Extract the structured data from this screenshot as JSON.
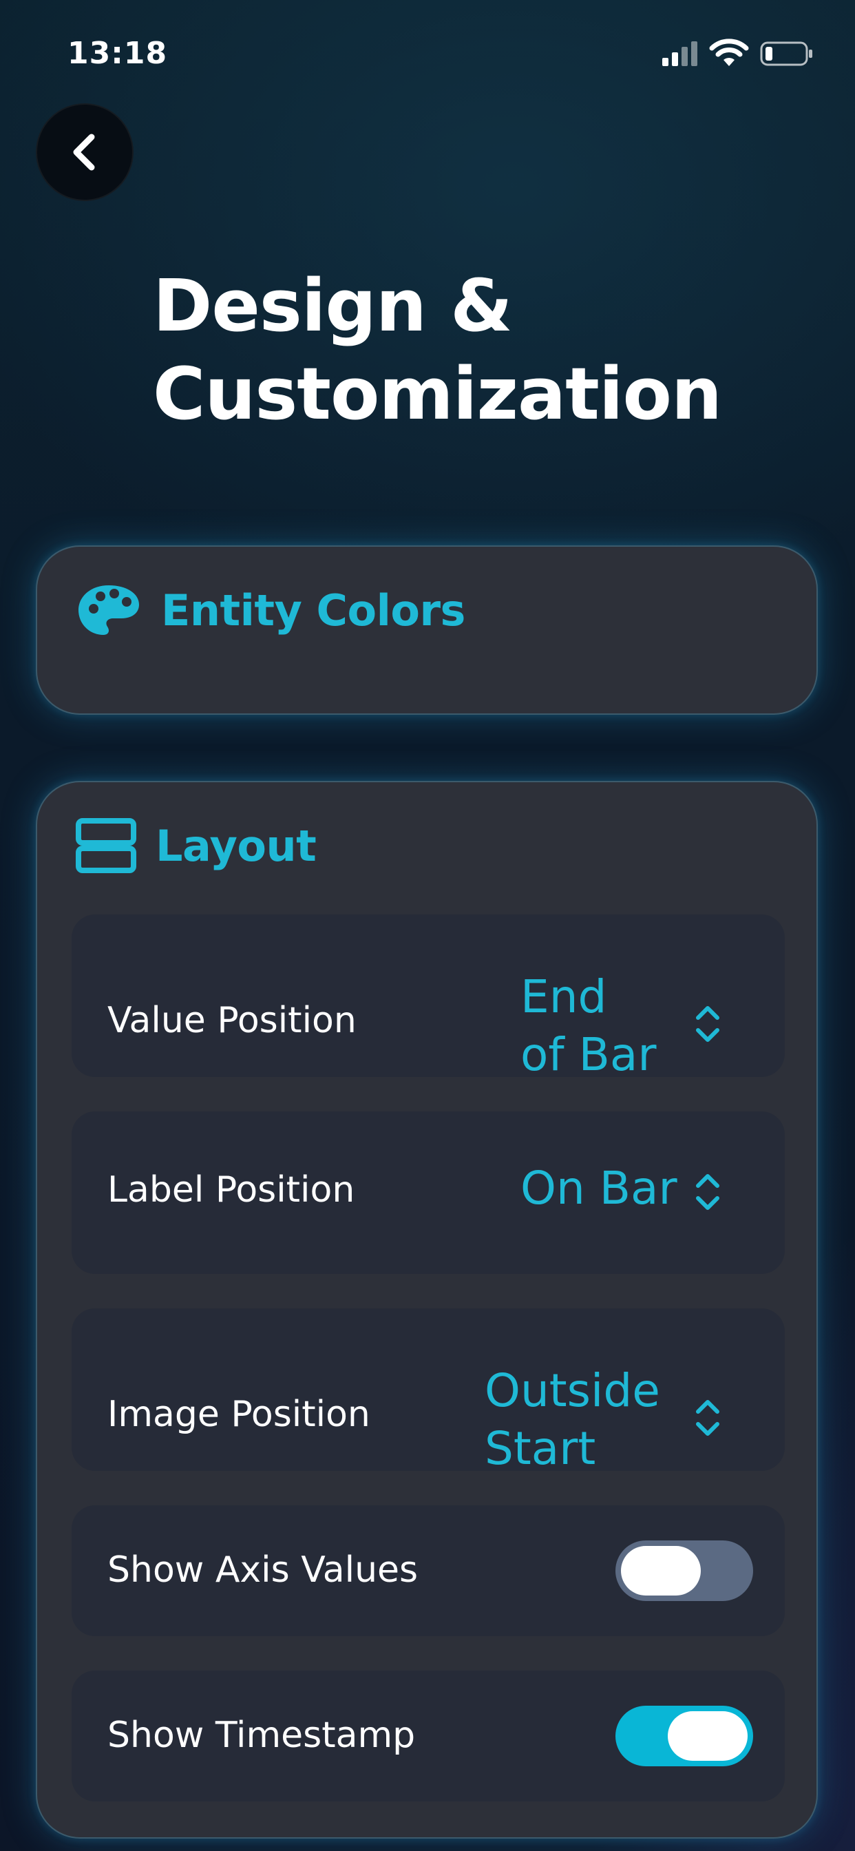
{
  "status_bar": {
    "time": "13:18",
    "icons": [
      "signal-icon",
      "wifi-icon",
      "battery-icon"
    ]
  },
  "navigation": {
    "back_icon": "chevron-left-icon"
  },
  "page": {
    "title_line1": "Design &",
    "title_line2": "Customization"
  },
  "entity_colors": {
    "icon": "palette-icon",
    "title": "Entity Colors"
  },
  "layout": {
    "icon": "rows-icon",
    "title": "Layout",
    "value_position": {
      "label": "Value Position",
      "value_line1": "End",
      "value_line2": "of Bar"
    },
    "label_position": {
      "label": "Label Position",
      "value": "On Bar"
    },
    "image_position": {
      "label": "Image Position",
      "value_line1": "Outside",
      "value_line2": "Start"
    },
    "show_axis_values": {
      "label": "Show Axis Values",
      "on": false
    },
    "show_timestamp": {
      "label": "Show Timestamp",
      "on": true
    }
  },
  "colors": {
    "accent": "#1fb9d6",
    "card": "#2d3039",
    "row": "#262b38",
    "toggle_off": "#5b6a83",
    "toggle_on": "#09b6d6"
  }
}
